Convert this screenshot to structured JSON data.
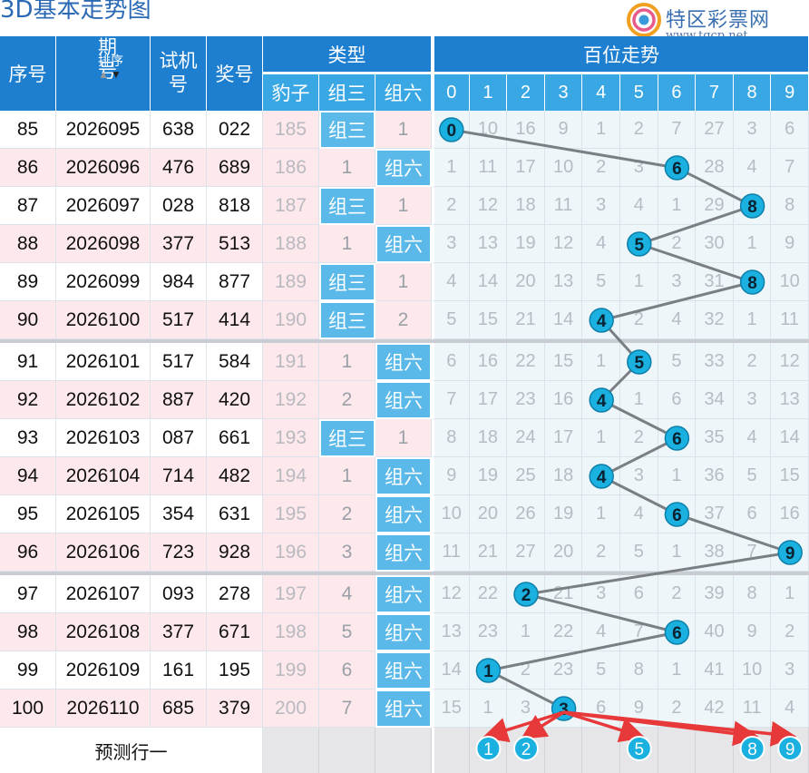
{
  "title": "3D基本走势图",
  "logo": {
    "name": "特区彩票网",
    "url": "www.tqcp.net"
  },
  "headers": {
    "seq": "序号",
    "period": [
      "期",
      "号"
    ],
    "sort": "排序",
    "trial": [
      "试机",
      "号"
    ],
    "prize": "奖号",
    "type_group": "类型",
    "type_cols": [
      "豹子",
      "组三",
      "组六"
    ],
    "trend_group": "百位走势",
    "digits": [
      "0",
      "1",
      "2",
      "3",
      "4",
      "5",
      "6",
      "7",
      "8",
      "9"
    ]
  },
  "rows": [
    {
      "seq": "85",
      "period": "2026095",
      "trial": "638",
      "prize": "022",
      "baozi": "185",
      "zu3": "组三",
      "zu6": "1",
      "trend": [
        "0",
        "10",
        "16",
        "9",
        "1",
        "2",
        "7",
        "27",
        "3",
        "6"
      ]
    },
    {
      "seq": "86",
      "period": "2026096",
      "trial": "476",
      "prize": "689",
      "baozi": "186",
      "zu3": "1",
      "zu6": "组六",
      "trend": [
        "1",
        "11",
        "17",
        "10",
        "2",
        "3",
        "6",
        "28",
        "4",
        "7"
      ]
    },
    {
      "seq": "87",
      "period": "2026097",
      "trial": "028",
      "prize": "818",
      "baozi": "187",
      "zu3": "组三",
      "zu6": "1",
      "trend": [
        "2",
        "12",
        "18",
        "11",
        "3",
        "4",
        "1",
        "29",
        "8",
        "8"
      ]
    },
    {
      "seq": "88",
      "period": "2026098",
      "trial": "377",
      "prize": "513",
      "baozi": "188",
      "zu3": "1",
      "zu6": "组六",
      "trend": [
        "3",
        "13",
        "19",
        "12",
        "4",
        "5",
        "2",
        "30",
        "1",
        "9"
      ]
    },
    {
      "seq": "89",
      "period": "2026099",
      "trial": "984",
      "prize": "877",
      "baozi": "189",
      "zu3": "组三",
      "zu6": "1",
      "trend": [
        "4",
        "14",
        "20",
        "13",
        "5",
        "1",
        "3",
        "31",
        "8",
        "10"
      ]
    },
    {
      "seq": "90",
      "period": "2026100",
      "trial": "517",
      "prize": "414",
      "baozi": "190",
      "zu3": "组三",
      "zu6": "2",
      "trend": [
        "5",
        "15",
        "21",
        "14",
        "4",
        "2",
        "4",
        "32",
        "1",
        "11"
      ]
    },
    {
      "seq": "91",
      "period": "2026101",
      "trial": "517",
      "prize": "584",
      "baozi": "191",
      "zu3": "1",
      "zu6": "组六",
      "trend": [
        "6",
        "16",
        "22",
        "15",
        "1",
        "5",
        "5",
        "33",
        "2",
        "12"
      ]
    },
    {
      "seq": "92",
      "period": "2026102",
      "trial": "887",
      "prize": "420",
      "baozi": "192",
      "zu3": "2",
      "zu6": "组六",
      "trend": [
        "7",
        "17",
        "23",
        "16",
        "4",
        "1",
        "6",
        "34",
        "3",
        "13"
      ]
    },
    {
      "seq": "93",
      "period": "2026103",
      "trial": "087",
      "prize": "661",
      "baozi": "193",
      "zu3": "组三",
      "zu6": "1",
      "trend": [
        "8",
        "18",
        "24",
        "17",
        "1",
        "2",
        "6",
        "35",
        "4",
        "14"
      ]
    },
    {
      "seq": "94",
      "period": "2026104",
      "trial": "714",
      "prize": "482",
      "baozi": "194",
      "zu3": "1",
      "zu6": "组六",
      "trend": [
        "9",
        "19",
        "25",
        "18",
        "4",
        "3",
        "1",
        "36",
        "5",
        "15"
      ]
    },
    {
      "seq": "95",
      "period": "2026105",
      "trial": "354",
      "prize": "631",
      "baozi": "195",
      "zu3": "2",
      "zu6": "组六",
      "trend": [
        "10",
        "20",
        "26",
        "19",
        "1",
        "4",
        "6",
        "37",
        "6",
        "16"
      ]
    },
    {
      "seq": "96",
      "period": "2026106",
      "trial": "723",
      "prize": "928",
      "baozi": "196",
      "zu3": "3",
      "zu6": "组六",
      "trend": [
        "11",
        "21",
        "27",
        "20",
        "2",
        "5",
        "1",
        "38",
        "7",
        "9"
      ]
    },
    {
      "seq": "97",
      "period": "2026107",
      "trial": "093",
      "prize": "278",
      "baozi": "197",
      "zu3": "4",
      "zu6": "组六",
      "trend": [
        "12",
        "22",
        "2",
        "21",
        "3",
        "6",
        "2",
        "39",
        "8",
        "1"
      ]
    },
    {
      "seq": "98",
      "period": "2026108",
      "trial": "377",
      "prize": "671",
      "baozi": "198",
      "zu3": "5",
      "zu6": "组六",
      "trend": [
        "13",
        "23",
        "1",
        "22",
        "4",
        "7",
        "6",
        "40",
        "9",
        "2"
      ]
    },
    {
      "seq": "99",
      "period": "2026109",
      "trial": "161",
      "prize": "195",
      "baozi": "199",
      "zu3": "6",
      "zu6": "组六",
      "trend": [
        "14",
        "1",
        "2",
        "23",
        "5",
        "8",
        "1",
        "41",
        "10",
        "3"
      ]
    },
    {
      "seq": "100",
      "period": "2026110",
      "trial": "685",
      "prize": "379",
      "baozi": "200",
      "zu3": "7",
      "zu6": "组六",
      "trend": [
        "15",
        "1",
        "3",
        "3",
        "6",
        "9",
        "2",
        "42",
        "11",
        "4"
      ]
    }
  ],
  "footer_label": "预测行一",
  "chart_data": {
    "type": "line",
    "title": "百位走势",
    "x": [
      "85",
      "86",
      "87",
      "88",
      "89",
      "90",
      "91",
      "92",
      "93",
      "94",
      "95",
      "96",
      "97",
      "98",
      "99",
      "100"
    ],
    "series": [
      {
        "values": [
          0,
          6,
          8,
          5,
          8,
          4,
          5,
          4,
          6,
          4,
          6,
          9,
          2,
          6,
          1,
          3
        ]
      }
    ],
    "prediction": [
      1,
      2,
      5,
      8,
      9
    ],
    "ylim": [
      0,
      9
    ],
    "colors": {
      "ball": "#1ab0e0",
      "line": "#7a7f84",
      "arrow": "#e8393a",
      "zu_badge": "#4cb8e8"
    }
  }
}
